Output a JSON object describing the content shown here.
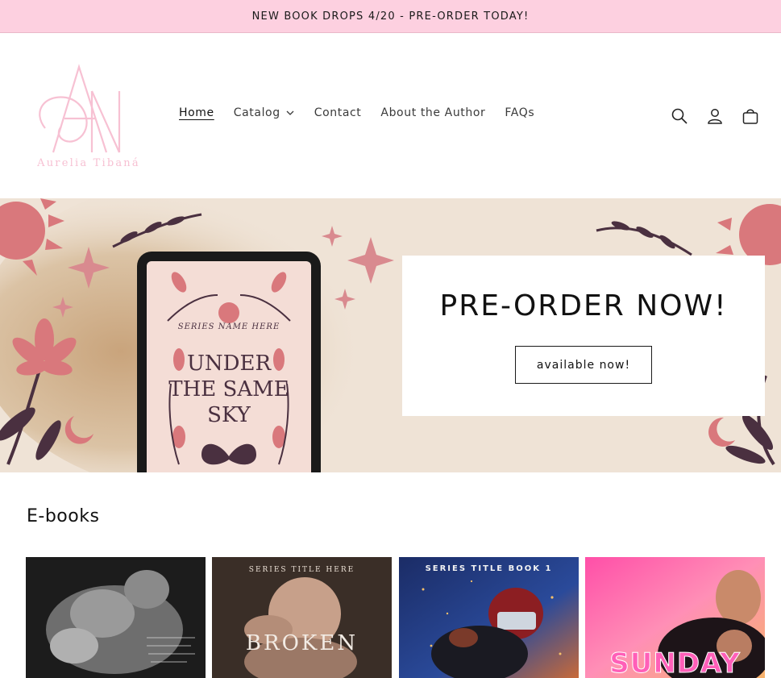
{
  "announcement": {
    "text": "NEW BOOK DROPS 4/20 - PRE-ORDER TODAY!"
  },
  "brand": {
    "monogram": "AN",
    "name": "Aurelia Tibaná"
  },
  "nav": {
    "items": [
      {
        "label": "Home",
        "active": true
      },
      {
        "label": "Catalog",
        "has_dropdown": true
      },
      {
        "label": "Contact"
      },
      {
        "label": "About the Author"
      },
      {
        "label": "FAQs"
      }
    ]
  },
  "header_icons": [
    "search-icon",
    "account-icon",
    "cart-icon"
  ],
  "hero": {
    "title": "PRE-ORDER NOW!",
    "button_label": "available now!",
    "tablet_cover": {
      "series": "SERIES NAME HERE",
      "title_lines": [
        "UNDER",
        "THE SAME",
        "SKY"
      ]
    }
  },
  "ebooks": {
    "heading": "E-books",
    "covers": [
      {
        "top_text": "",
        "big_text": ""
      },
      {
        "top_text": "SERIES TITLE HERE",
        "big_text": "BROKEN"
      },
      {
        "top_text": "SERIES TITLE BOOK 1",
        "big_text": ""
      },
      {
        "top_text": "",
        "big_text": "SUNDAY"
      }
    ]
  },
  "colors": {
    "announce_bg": "#fdd0e0",
    "brand_pink": "#f7c1d3",
    "accent_rose": "#d9787c",
    "plum": "#4a3040"
  }
}
